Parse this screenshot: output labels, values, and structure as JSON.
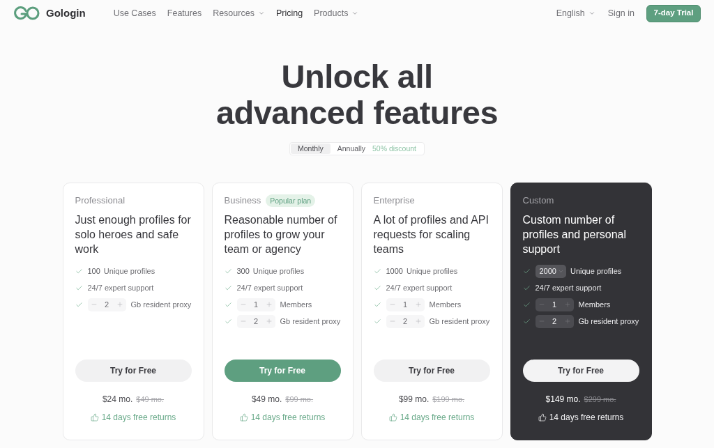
{
  "nav": {
    "logo": "Gologin",
    "links": [
      {
        "label": "Use Cases",
        "dropdown": false,
        "selected": false
      },
      {
        "label": "Features",
        "dropdown": false,
        "selected": false
      },
      {
        "label": "Resources",
        "dropdown": true,
        "selected": false
      },
      {
        "label": "Pricing",
        "dropdown": false,
        "selected": true
      },
      {
        "label": "Products",
        "dropdown": true,
        "selected": false
      }
    ],
    "language": "English",
    "sign_in": "Sign in",
    "trial_button": "7-day Trial"
  },
  "hero": {
    "title_lines": [
      "Unlock all",
      "advanced features"
    ]
  },
  "billing_toggle": {
    "options": [
      {
        "label": "Monthly",
        "selected": true
      },
      {
        "label": "Annually",
        "selected": false
      }
    ],
    "discount": "50% discount"
  },
  "plans": [
    {
      "name": "Professional",
      "dark": false,
      "description": "Just enough profiles for solo heroes and safe work",
      "features": [
        {
          "kind": "count",
          "value": "100",
          "label": "Unique profiles"
        },
        {
          "kind": "text",
          "label": "24/7 expert support"
        },
        {
          "kind": "stepper",
          "value": "2",
          "label": "Gb resident proxy"
        }
      ],
      "button": "Try for Free",
      "highlighted": false,
      "price": "$24 mo.",
      "old_price": "$49 mo.",
      "returns": "14 days free returns"
    },
    {
      "name": "Business",
      "badge": "Popular plan",
      "dark": false,
      "description": "Reasonable number of profiles to grow your team or agency",
      "features": [
        {
          "kind": "count",
          "value": "300",
          "label": "Unique profiles"
        },
        {
          "kind": "text",
          "label": "24/7 expert support"
        },
        {
          "kind": "stepper",
          "value": "1",
          "label": "Members"
        },
        {
          "kind": "stepper",
          "value": "2",
          "label": "Gb resident proxy"
        }
      ],
      "button": "Try for Free",
      "highlighted": true,
      "price": "$49 mo.",
      "old_price": "$99 mo.",
      "returns": "14 days free returns"
    },
    {
      "name": "Enterprise",
      "dark": false,
      "description": "A lot of profiles and API requests for scaling teams",
      "features": [
        {
          "kind": "count",
          "value": "1000",
          "label": "Unique profiles"
        },
        {
          "kind": "text",
          "label": "24/7 expert support"
        },
        {
          "kind": "stepper",
          "value": "1",
          "label": "Members"
        },
        {
          "kind": "stepper",
          "value": "2",
          "label": "Gb resident proxy"
        }
      ],
      "button": "Try for Free",
      "highlighted": false,
      "price": "$99 mo.",
      "old_price": "$199 mo.",
      "returns": "14 days free returns"
    },
    {
      "name": "Custom",
      "dark": true,
      "description": "Custom number of profiles and personal support",
      "features": [
        {
          "kind": "select",
          "value": "2000",
          "label": "Unique profiles"
        },
        {
          "kind": "text",
          "label": "24/7 expert support"
        },
        {
          "kind": "stepper",
          "value": "1",
          "label": "Members"
        },
        {
          "kind": "stepper",
          "value": "2",
          "label": "Gb resident proxy"
        }
      ],
      "button": "Try for Free",
      "highlighted": false,
      "price": "$149 mo.",
      "old_price": "$299 mo.",
      "returns": "14 days free returns"
    }
  ]
}
